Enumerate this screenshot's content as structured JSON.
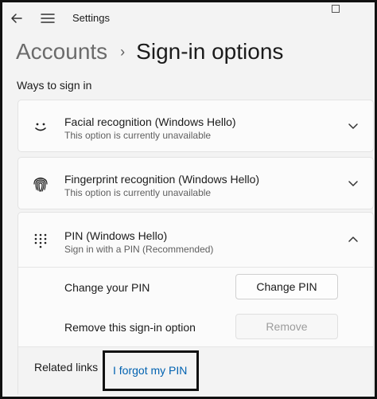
{
  "window": {
    "title": "Settings"
  },
  "breadcrumb": {
    "parent": "Accounts",
    "separator": "›",
    "current": "Sign-in options"
  },
  "section": {
    "title": "Ways to sign in"
  },
  "options": {
    "face": {
      "title": "Facial recognition (Windows Hello)",
      "subtitle": "This option is currently unavailable",
      "icon": "smiley-face-icon",
      "expanded": false
    },
    "fingerprint": {
      "title": "Fingerprint recognition (Windows Hello)",
      "subtitle": "This option is currently unavailable",
      "icon": "fingerprint-icon",
      "expanded": false
    },
    "pin": {
      "title": "PIN (Windows Hello)",
      "subtitle": "Sign in with a PIN (Recommended)",
      "icon": "keypad-icon",
      "expanded": true,
      "change_label": "Change your PIN",
      "change_button": "Change PIN",
      "remove_label": "Remove this sign-in option",
      "remove_button": "Remove",
      "related_label": "Related links",
      "forgot_link": "I forgot my PIN"
    }
  },
  "colors": {
    "link": "#0062b1",
    "background": "#f3f3f3",
    "card": "#fbfbfb",
    "highlight_box": "#111111"
  }
}
